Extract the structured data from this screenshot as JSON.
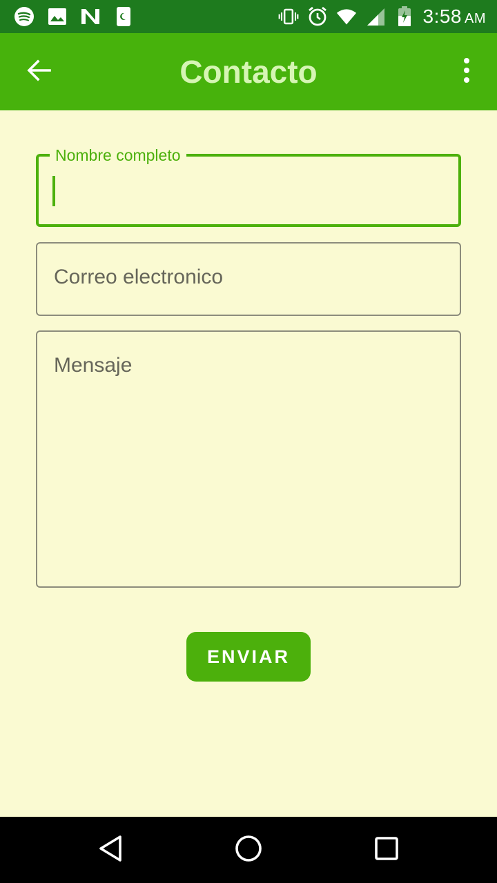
{
  "status_bar": {
    "time": "3:58",
    "ampm": "AM",
    "left_icons": [
      "spotify-icon",
      "image-icon",
      "n-app-icon",
      "phone-moon-icon"
    ],
    "right_icons": [
      "vibrate-icon",
      "alarm-icon",
      "wifi-icon",
      "signal-icon",
      "battery-icon"
    ]
  },
  "app_bar": {
    "title": "Contacto",
    "back_icon": "arrow-back-icon",
    "menu_icon": "more-vert-icon"
  },
  "form": {
    "name_label": "Nombre completo",
    "name_value": "",
    "email_placeholder": "Correo electronico",
    "message_placeholder": "Mensaje",
    "submit_label": "ENVIAR"
  },
  "nav_bar": {
    "buttons": [
      "back-triangle-icon",
      "home-circle-icon",
      "recents-square-icon"
    ]
  },
  "colors": {
    "status_bar": "#1e7b1e",
    "app_bar": "#47b20c",
    "title_text": "#d6f5b4",
    "background": "#fafad2",
    "accent": "#4cb00c",
    "field_border": "#8c8c7c",
    "placeholder": "#66665a"
  }
}
